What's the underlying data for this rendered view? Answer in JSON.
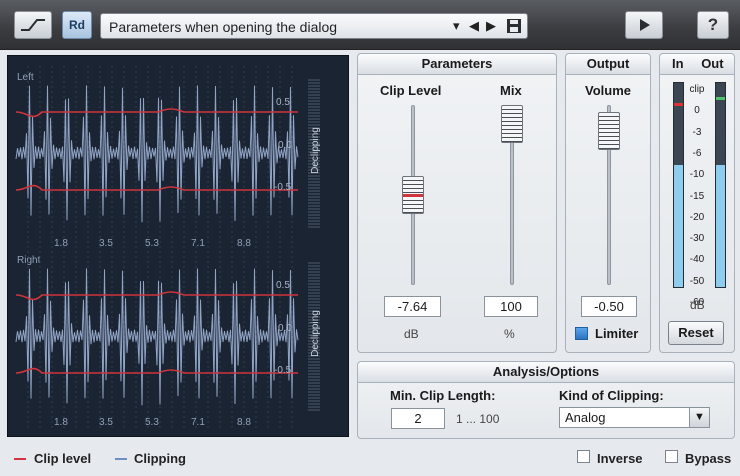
{
  "toolbar": {
    "rd_label": "Rd",
    "preset_label": "Parameters when opening the dialog",
    "help_label": "?"
  },
  "waveform": {
    "left_label": "Left",
    "right_label": "Right",
    "time_ticks": [
      "1.8",
      "3.5",
      "5.3",
      "7.1",
      "8.8"
    ],
    "level_ticks": [
      "0.5",
      "0.0",
      "-0.5"
    ],
    "declipping_label": "Declipping"
  },
  "parameters": {
    "title": "Parameters",
    "clip_level": {
      "label": "Clip Level",
      "value": "-7.64",
      "unit": "dB"
    },
    "mix": {
      "label": "Mix",
      "value": "100",
      "unit": "%"
    }
  },
  "output": {
    "title": "Output",
    "volume": {
      "label": "Volume",
      "value": "-0.50"
    },
    "limiter_label": "Limiter",
    "limiter_checked": true
  },
  "meter": {
    "in_label": "In",
    "out_label": "Out",
    "scale": [
      "clip",
      "0",
      "-3",
      "-6",
      "-10",
      "-15",
      "-20",
      "-30",
      "-40",
      "-50",
      "-60"
    ],
    "unit": "dB",
    "reset_label": "Reset",
    "in_level": 0.6,
    "out_level": 0.6
  },
  "analysis": {
    "title": "Analysis/Options",
    "min_clip_length": {
      "label": "Min. Clip Length:",
      "value": "2",
      "range": "1 ... 100"
    },
    "kind_of_clipping": {
      "label": "Kind of Clipping:",
      "value": "Analog"
    }
  },
  "footer": {
    "clip_level_legend": "Clip level",
    "clipping_legend": "Clipping",
    "inverse_label": "Inverse",
    "bypass_label": "Bypass",
    "colors": {
      "clip_level": "#d0343c",
      "clipping": "#6f8fc0"
    }
  }
}
